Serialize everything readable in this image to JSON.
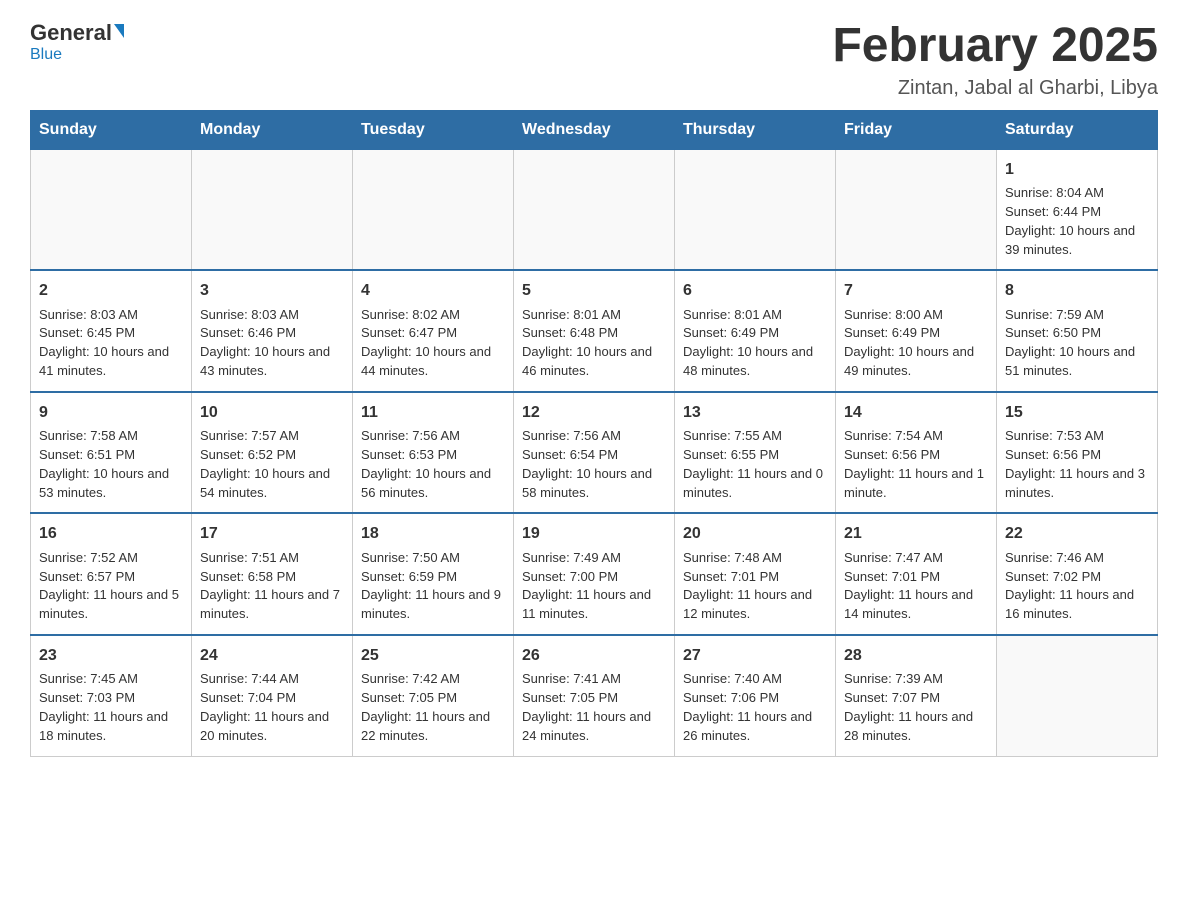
{
  "header": {
    "logo_general": "General",
    "logo_blue": "Blue",
    "month_title": "February 2025",
    "location": "Zintan, Jabal al Gharbi, Libya"
  },
  "days_of_week": [
    "Sunday",
    "Monday",
    "Tuesday",
    "Wednesday",
    "Thursday",
    "Friday",
    "Saturday"
  ],
  "weeks": [
    [
      {
        "day": "",
        "info": ""
      },
      {
        "day": "",
        "info": ""
      },
      {
        "day": "",
        "info": ""
      },
      {
        "day": "",
        "info": ""
      },
      {
        "day": "",
        "info": ""
      },
      {
        "day": "",
        "info": ""
      },
      {
        "day": "1",
        "info": "Sunrise: 8:04 AM\nSunset: 6:44 PM\nDaylight: 10 hours and 39 minutes."
      }
    ],
    [
      {
        "day": "2",
        "info": "Sunrise: 8:03 AM\nSunset: 6:45 PM\nDaylight: 10 hours and 41 minutes."
      },
      {
        "day": "3",
        "info": "Sunrise: 8:03 AM\nSunset: 6:46 PM\nDaylight: 10 hours and 43 minutes."
      },
      {
        "day": "4",
        "info": "Sunrise: 8:02 AM\nSunset: 6:47 PM\nDaylight: 10 hours and 44 minutes."
      },
      {
        "day": "5",
        "info": "Sunrise: 8:01 AM\nSunset: 6:48 PM\nDaylight: 10 hours and 46 minutes."
      },
      {
        "day": "6",
        "info": "Sunrise: 8:01 AM\nSunset: 6:49 PM\nDaylight: 10 hours and 48 minutes."
      },
      {
        "day": "7",
        "info": "Sunrise: 8:00 AM\nSunset: 6:49 PM\nDaylight: 10 hours and 49 minutes."
      },
      {
        "day": "8",
        "info": "Sunrise: 7:59 AM\nSunset: 6:50 PM\nDaylight: 10 hours and 51 minutes."
      }
    ],
    [
      {
        "day": "9",
        "info": "Sunrise: 7:58 AM\nSunset: 6:51 PM\nDaylight: 10 hours and 53 minutes."
      },
      {
        "day": "10",
        "info": "Sunrise: 7:57 AM\nSunset: 6:52 PM\nDaylight: 10 hours and 54 minutes."
      },
      {
        "day": "11",
        "info": "Sunrise: 7:56 AM\nSunset: 6:53 PM\nDaylight: 10 hours and 56 minutes."
      },
      {
        "day": "12",
        "info": "Sunrise: 7:56 AM\nSunset: 6:54 PM\nDaylight: 10 hours and 58 minutes."
      },
      {
        "day": "13",
        "info": "Sunrise: 7:55 AM\nSunset: 6:55 PM\nDaylight: 11 hours and 0 minutes."
      },
      {
        "day": "14",
        "info": "Sunrise: 7:54 AM\nSunset: 6:56 PM\nDaylight: 11 hours and 1 minute."
      },
      {
        "day": "15",
        "info": "Sunrise: 7:53 AM\nSunset: 6:56 PM\nDaylight: 11 hours and 3 minutes."
      }
    ],
    [
      {
        "day": "16",
        "info": "Sunrise: 7:52 AM\nSunset: 6:57 PM\nDaylight: 11 hours and 5 minutes."
      },
      {
        "day": "17",
        "info": "Sunrise: 7:51 AM\nSunset: 6:58 PM\nDaylight: 11 hours and 7 minutes."
      },
      {
        "day": "18",
        "info": "Sunrise: 7:50 AM\nSunset: 6:59 PM\nDaylight: 11 hours and 9 minutes."
      },
      {
        "day": "19",
        "info": "Sunrise: 7:49 AM\nSunset: 7:00 PM\nDaylight: 11 hours and 11 minutes."
      },
      {
        "day": "20",
        "info": "Sunrise: 7:48 AM\nSunset: 7:01 PM\nDaylight: 11 hours and 12 minutes."
      },
      {
        "day": "21",
        "info": "Sunrise: 7:47 AM\nSunset: 7:01 PM\nDaylight: 11 hours and 14 minutes."
      },
      {
        "day": "22",
        "info": "Sunrise: 7:46 AM\nSunset: 7:02 PM\nDaylight: 11 hours and 16 minutes."
      }
    ],
    [
      {
        "day": "23",
        "info": "Sunrise: 7:45 AM\nSunset: 7:03 PM\nDaylight: 11 hours and 18 minutes."
      },
      {
        "day": "24",
        "info": "Sunrise: 7:44 AM\nSunset: 7:04 PM\nDaylight: 11 hours and 20 minutes."
      },
      {
        "day": "25",
        "info": "Sunrise: 7:42 AM\nSunset: 7:05 PM\nDaylight: 11 hours and 22 minutes."
      },
      {
        "day": "26",
        "info": "Sunrise: 7:41 AM\nSunset: 7:05 PM\nDaylight: 11 hours and 24 minutes."
      },
      {
        "day": "27",
        "info": "Sunrise: 7:40 AM\nSunset: 7:06 PM\nDaylight: 11 hours and 26 minutes."
      },
      {
        "day": "28",
        "info": "Sunrise: 7:39 AM\nSunset: 7:07 PM\nDaylight: 11 hours and 28 minutes."
      },
      {
        "day": "",
        "info": ""
      }
    ]
  ]
}
